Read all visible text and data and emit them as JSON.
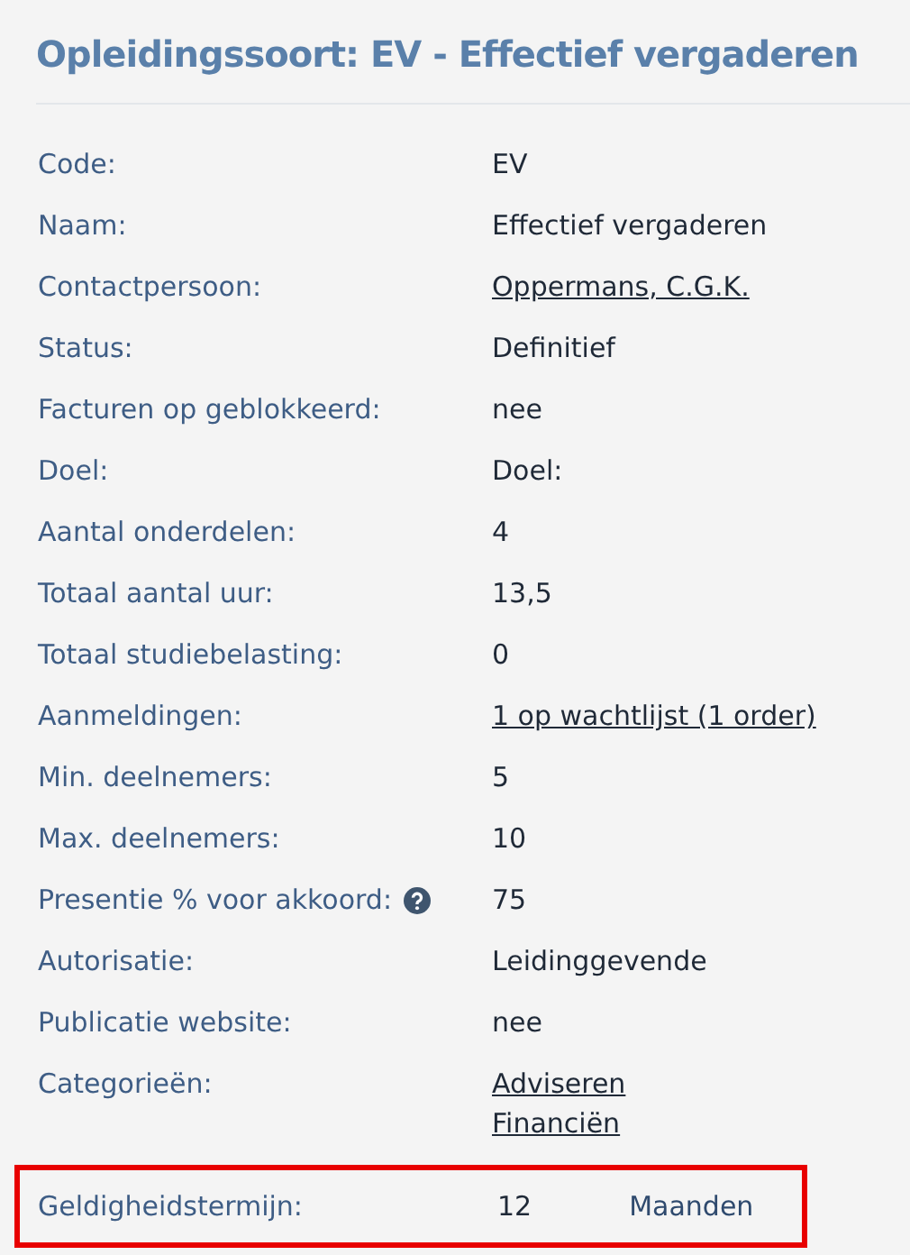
{
  "title": "Opleidingssoort: EV - Effectief vergaderen",
  "rows": [
    {
      "label": "Code:",
      "values": [
        {
          "kind": "text",
          "text": "EV"
        }
      ]
    },
    {
      "label": "Naam:",
      "values": [
        {
          "kind": "text",
          "text": "Effectief vergaderen"
        }
      ]
    },
    {
      "label": "Contactpersoon:",
      "values": [
        {
          "kind": "link",
          "text": "Oppermans, C.G.K."
        }
      ]
    },
    {
      "label": "Status:",
      "values": [
        {
          "kind": "text",
          "text": "Definitief"
        }
      ]
    },
    {
      "label": "Facturen op geblokkeerd:",
      "values": [
        {
          "kind": "text",
          "text": "nee"
        }
      ]
    },
    {
      "label": "Doel:",
      "values": [
        {
          "kind": "text",
          "text": "Doel:"
        }
      ]
    },
    {
      "label": "Aantal onderdelen:",
      "values": [
        {
          "kind": "text",
          "text": "4"
        }
      ]
    },
    {
      "label": "Totaal aantal uur:",
      "values": [
        {
          "kind": "text",
          "text": "13,5"
        }
      ]
    },
    {
      "label": "Totaal studiebelasting:",
      "values": [
        {
          "kind": "text",
          "text": "0"
        }
      ]
    },
    {
      "label": "Aanmeldingen:",
      "values": [
        {
          "kind": "link",
          "text": "1 op wachtlijst (1 order)"
        }
      ]
    },
    {
      "label": "Min. deelnemers:",
      "values": [
        {
          "kind": "text",
          "text": "5"
        }
      ]
    },
    {
      "label": "Max. deelnemers:",
      "values": [
        {
          "kind": "text",
          "text": "10"
        }
      ]
    },
    {
      "label": "Presentie % voor akkoord:",
      "help": true,
      "values": [
        {
          "kind": "text",
          "text": "75"
        }
      ]
    },
    {
      "label": "Autorisatie:",
      "values": [
        {
          "kind": "text",
          "text": "Leidinggevende"
        }
      ]
    },
    {
      "label": "Publicatie website:",
      "values": [
        {
          "kind": "text",
          "text": "nee"
        }
      ]
    },
    {
      "label": "Categorieën:",
      "values": [
        {
          "kind": "link",
          "text": "Adviseren"
        },
        {
          "kind": "link",
          "text": "Financiën"
        }
      ]
    },
    {
      "label": "Geldigheidstermijn:",
      "highlighted": true,
      "values": [
        {
          "kind": "text",
          "text": "12"
        },
        {
          "kind": "unit",
          "text": "Maanden"
        }
      ]
    }
  ]
}
